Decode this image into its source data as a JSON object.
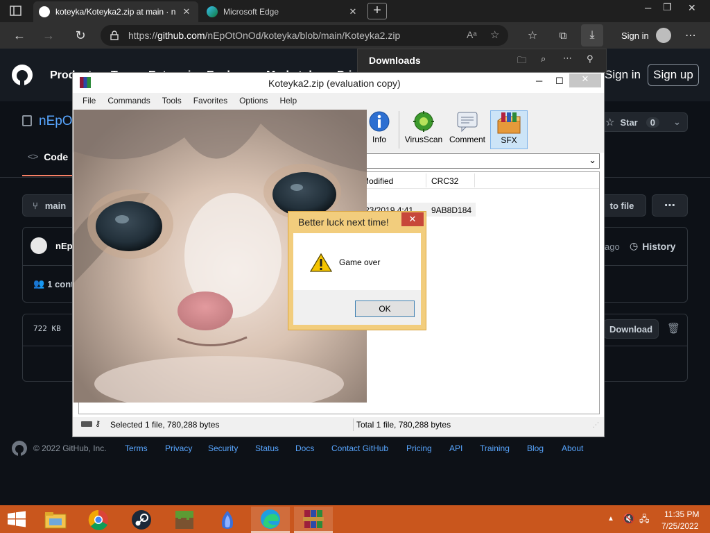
{
  "browser": {
    "tabs": [
      {
        "title": "koteyka/Koteyka2.zip at main · n"
      },
      {
        "title": "Microsoft Edge"
      }
    ],
    "url": {
      "prefix": "https://",
      "host": "github.com",
      "path": "/nEpOtOnOd/koteyka/blob/main/Koteyka2.zip"
    },
    "sign_in_label": "Sign in",
    "downloads_title": "Downloads"
  },
  "github": {
    "nav": [
      "Product",
      "Team",
      "Enterprise",
      "Explore",
      "Marketplace",
      "Pricing"
    ],
    "sign_in": "Sign in",
    "sign_up": "Sign up",
    "repo_owner_fragment": "nEpO",
    "star_label": "Star",
    "star_count": "0",
    "code_tab": "Code",
    "branch": "main",
    "goto_file": "to file",
    "commit_author": "nEp",
    "commit_age": "ago",
    "history": "History",
    "contributors": "1 cont",
    "file_size": "722 KB",
    "download": "Download",
    "footer": {
      "copyright": "© 2022 GitHub, Inc.",
      "links": [
        "Terms",
        "Privacy",
        "Security",
        "Status",
        "Docs",
        "Contact GitHub",
        "Pricing",
        "API",
        "Training",
        "Blog",
        "About"
      ]
    }
  },
  "winrar": {
    "title": "Koteyka2.zip (evaluation copy)",
    "menu": [
      "File",
      "Commands",
      "Tools",
      "Favorites",
      "Options",
      "Help"
    ],
    "tools": [
      {
        "label": "Info",
        "icon": "info-icon"
      },
      {
        "label": "VirusScan",
        "icon": "virus-scan-icon"
      },
      {
        "label": "Comment",
        "icon": "comment-icon"
      },
      {
        "label": "SFX",
        "icon": "sfx-icon"
      }
    ],
    "columns": [
      "Modified",
      "CRC32"
    ],
    "row": {
      "modified": "23/2019 4:41",
      "crc": "9AB8D184"
    },
    "status_left": "Selected 1 file, 780,288 bytes",
    "status_right": "Total 1 file, 780,288 bytes"
  },
  "dialog": {
    "title": "Better luck next time!",
    "message": "Game over",
    "ok": "OK"
  },
  "taskbar": {
    "time": "11:35 PM",
    "date": "7/25/2022"
  },
  "colors": {
    "taskbar": "#c9561d",
    "github_bg": "#0d1117",
    "dialog_frame": "#f2cd7d",
    "link_blue": "#58a6ff"
  }
}
